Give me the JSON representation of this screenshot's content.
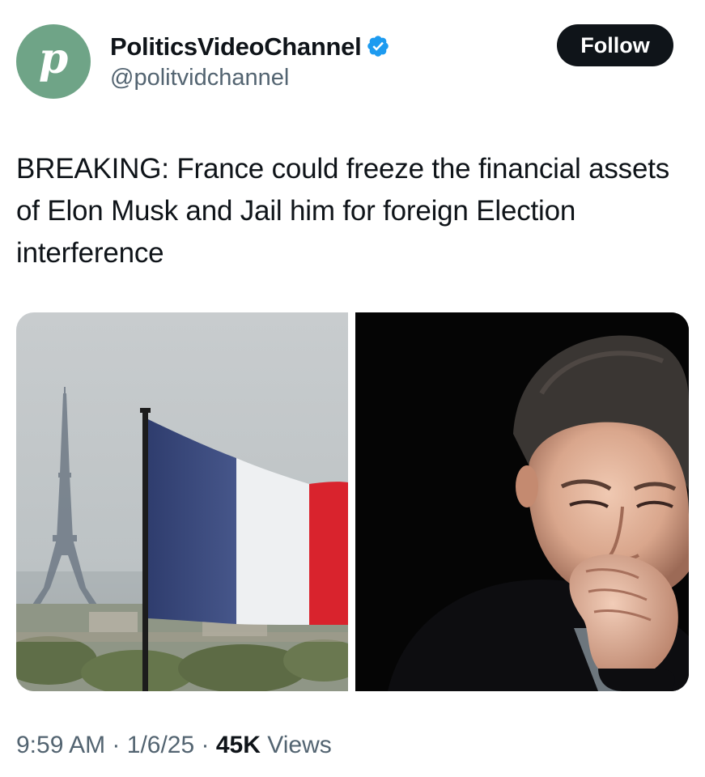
{
  "author": {
    "avatar_letter": "p",
    "display_name": "PoliticsVideoChannel",
    "verified": true,
    "handle": "@politvidchannel"
  },
  "follow_label": "Follow",
  "tweet": {
    "text": "BREAKING: France could freeze the financial assets of Elon Musk and Jail him for foreign Election interference"
  },
  "media": {
    "left_image": "French flag with Eiffel Tower",
    "right_image": "Man holding fist to mouth"
  },
  "meta": {
    "time": "9:59 AM",
    "date": "1/6/25",
    "views_count": "45K",
    "views_label": "Views",
    "separator": "·"
  },
  "colors": {
    "avatar": "#6fa487",
    "verified": "#1d9bf0",
    "follow_bg": "#0f1419",
    "secondary_text": "#536471",
    "flag_blue": "#3b4a7a",
    "flag_red": "#d9232d"
  }
}
